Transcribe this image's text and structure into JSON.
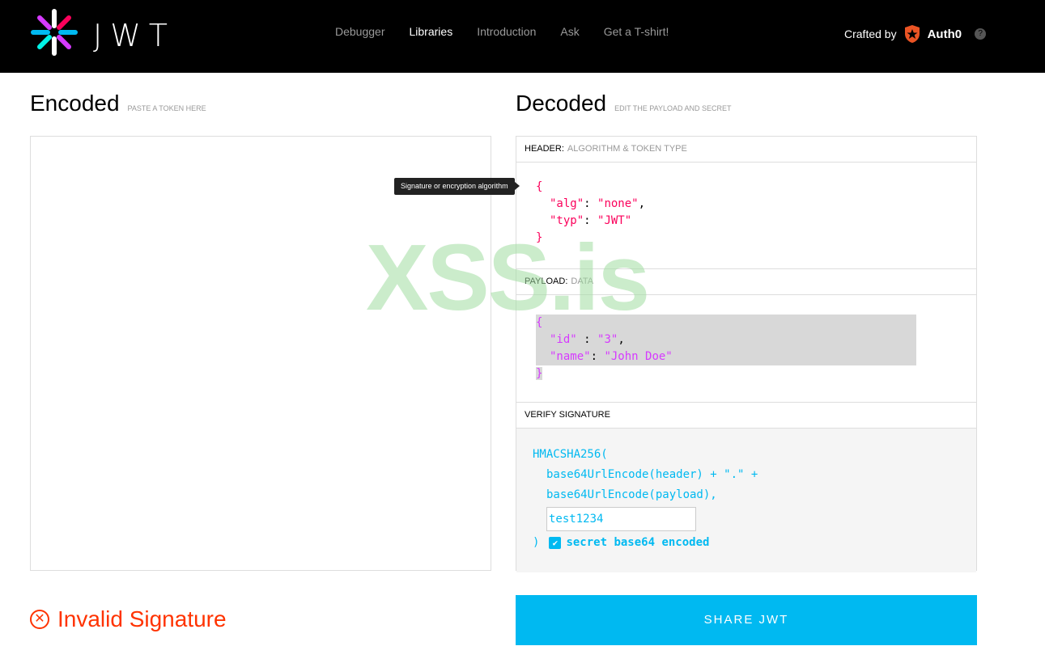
{
  "brand": {
    "word": "JWT"
  },
  "nav": {
    "items": [
      {
        "label": "Debugger",
        "active": false
      },
      {
        "label": "Libraries",
        "active": true
      },
      {
        "label": "Introduction",
        "active": false
      },
      {
        "label": "Ask",
        "active": false
      },
      {
        "label": "Get a T-shirt!",
        "active": false
      }
    ]
  },
  "crafted": {
    "label": "Crafted by",
    "company": "Auth0",
    "help": "?"
  },
  "encoded": {
    "title": "Encoded",
    "subtitle": "PASTE A TOKEN HERE"
  },
  "decoded": {
    "title": "Decoded",
    "subtitle": "EDIT THE PAYLOAD AND SECRET",
    "header_panel": {
      "label": "HEADER:",
      "sub": "ALGORITHM & TOKEN TYPE",
      "tooltip": "Signature or encryption algorithm",
      "lines": {
        "open": "{",
        "alg_key": "\"alg\"",
        "alg_val": "\"none\"",
        "typ_key": "\"typ\"",
        "typ_val": "\"JWT\"",
        "close": "}"
      }
    },
    "payload_panel": {
      "label": "PAYLOAD:",
      "sub": "DATA",
      "lines": {
        "open": "{",
        "id_key": "\"id\"",
        "id_val": "\"3\"",
        "name_key": "\"name\"",
        "name_val": "\"John Doe\"",
        "close": "}"
      }
    },
    "verify_panel": {
      "label": "VERIFY SIGNATURE",
      "fn": "HMACSHA256(",
      "line1": "base64UrlEncode(header) + \".\" +",
      "line2": "base64UrlEncode(payload),",
      "secret": "test1234",
      "close": ")",
      "checkbox_label": "secret base64 encoded",
      "checked": true
    }
  },
  "watermark": "XSS.is",
  "status": {
    "text": "Invalid Signature"
  },
  "share": {
    "label": "SHARE JWT"
  },
  "colors": {
    "accent": "#00b9f1",
    "error": "#ff3300",
    "header_red": "#fb015b",
    "payload_purple": "#d63aff"
  }
}
